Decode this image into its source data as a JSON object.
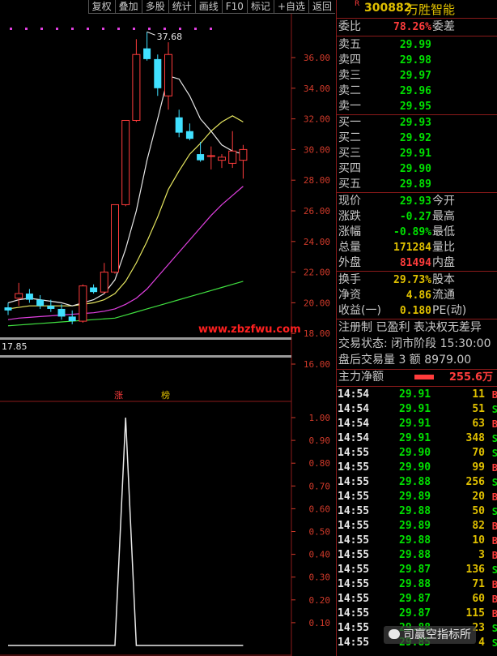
{
  "toolbar": {
    "buttons": [
      "复权",
      "叠加",
      "多股",
      "统计",
      "画线",
      "F10",
      "标记",
      "+自选",
      "返回"
    ]
  },
  "colors": {
    "background": "#000000",
    "up_red": "#ff3c3c",
    "down_cyan": "#40e0ff",
    "ma5_white": "#e8e8e8",
    "ma10_yellow": "#e8e860",
    "ma20_magenta": "#e040e0",
    "ma60_green": "#40e040",
    "volume_yellow": "#e0c000"
  },
  "main_chart": {
    "y_ticks": [
      "36.00",
      "34.00",
      "32.00",
      "30.00",
      "28.00",
      "26.00",
      "24.00",
      "22.00",
      "20.00",
      "18.00",
      "16.00"
    ],
    "high_label": "37.68",
    "low_label": "17.85",
    "watermark": "www.zbzfwu.com",
    "candles": [
      {
        "o": 19.7,
        "h": 20.0,
        "l": 19.2,
        "c": 19.5
      },
      {
        "o": 20.3,
        "h": 21.3,
        "l": 19.8,
        "c": 20.6
      },
      {
        "o": 20.6,
        "h": 20.9,
        "l": 20.0,
        "c": 20.2
      },
      {
        "o": 20.2,
        "h": 20.5,
        "l": 19.6,
        "c": 19.8
      },
      {
        "o": 19.8,
        "h": 20.2,
        "l": 19.4,
        "c": 19.6
      },
      {
        "o": 19.6,
        "h": 19.9,
        "l": 18.9,
        "c": 19.1
      },
      {
        "o": 19.1,
        "h": 19.5,
        "l": 18.6,
        "c": 18.8
      },
      {
        "o": 18.8,
        "h": 21.2,
        "l": 18.7,
        "c": 21.1
      },
      {
        "o": 21.0,
        "h": 21.2,
        "l": 20.6,
        "c": 20.7
      },
      {
        "o": 20.7,
        "h": 22.6,
        "l": 20.6,
        "c": 22.0
      },
      {
        "o": 22.0,
        "h": 26.4,
        "l": 21.9,
        "c": 26.4
      },
      {
        "o": 26.4,
        "h": 31.9,
        "l": 26.3,
        "c": 31.9
      },
      {
        "o": 31.9,
        "h": 37.2,
        "l": 31.8,
        "c": 36.2
      },
      {
        "o": 36.6,
        "h": 37.68,
        "l": 35.8,
        "c": 35.9
      },
      {
        "o": 35.9,
        "h": 36.2,
        "l": 33.5,
        "c": 34.0
      },
      {
        "o": 33.5,
        "h": 37.0,
        "l": 32.6,
        "c": 36.2
      },
      {
        "o": 32.1,
        "h": 32.6,
        "l": 30.8,
        "c": 31.1
      },
      {
        "o": 31.2,
        "h": 31.7,
        "l": 30.6,
        "c": 30.7
      },
      {
        "o": 29.7,
        "h": 30.5,
        "l": 29.2,
        "c": 29.3
      },
      {
        "o": 29.6,
        "h": 30.2,
        "l": 28.7,
        "c": 29.6
      },
      {
        "o": 29.3,
        "h": 29.7,
        "l": 28.8,
        "c": 29.5
      },
      {
        "o": 29.1,
        "h": 31.2,
        "l": 28.8,
        "c": 29.9
      },
      {
        "o": 29.3,
        "h": 30.3,
        "l": 28.1,
        "c": 30.0
      }
    ],
    "ma5": [
      20.0,
      20.2,
      20.3,
      20.2,
      20.1,
      20.0,
      19.8,
      20.0,
      20.2,
      20.6,
      21.5,
      23.5,
      26.0,
      29.3,
      32.0,
      34.8,
      34.6,
      33.5,
      32.0,
      31.2,
      30.3,
      29.9,
      29.7
    ],
    "ma10": [
      19.6,
      19.7,
      19.8,
      19.8,
      19.8,
      19.8,
      19.8,
      19.9,
      20.0,
      20.2,
      20.6,
      21.4,
      22.6,
      24.0,
      25.6,
      27.4,
      28.6,
      29.7,
      30.4,
      31.2,
      31.8,
      32.2,
      31.8
    ],
    "ma20": [
      18.9,
      19.0,
      19.05,
      19.1,
      19.15,
      19.2,
      19.25,
      19.3,
      19.35,
      19.45,
      19.6,
      19.9,
      20.3,
      20.9,
      21.7,
      22.5,
      23.3,
      24.1,
      24.9,
      25.7,
      26.4,
      27.0,
      27.6
    ],
    "ma60": [
      18.5,
      18.55,
      18.6,
      18.65,
      18.7,
      18.75,
      18.8,
      18.85,
      18.9,
      18.95,
      19.0,
      19.2,
      19.4,
      19.6,
      19.8,
      20.0,
      20.2,
      20.4,
      20.6,
      20.8,
      21.0,
      21.2,
      21.4
    ]
  },
  "sub_chart": {
    "markers": [
      "涨",
      "榜"
    ],
    "y_ticks": [
      "1.00",
      "0.90",
      "0.80",
      "0.70",
      "0.60",
      "0.50",
      "0.40",
      "0.30",
      "0.20",
      "0.10"
    ],
    "values": [
      0,
      0,
      0,
      0,
      0,
      0,
      0,
      0,
      0,
      0,
      0,
      1,
      0,
      0,
      0,
      0,
      0,
      0,
      0,
      0,
      0,
      0,
      0
    ]
  },
  "quote": {
    "code": "300882",
    "name": "万胜智能",
    "r_badge": "R",
    "weibi_label": "委比",
    "weibi_value": "78.26%",
    "weicha_label": "委差",
    "asks": [
      {
        "label": "卖五",
        "price": "29.99"
      },
      {
        "label": "卖四",
        "price": "29.98"
      },
      {
        "label": "卖三",
        "price": "29.97"
      },
      {
        "label": "卖二",
        "price": "29.96"
      },
      {
        "label": "卖一",
        "price": "29.95"
      }
    ],
    "bids": [
      {
        "label": "买一",
        "price": "29.93"
      },
      {
        "label": "买二",
        "price": "29.92"
      },
      {
        "label": "买三",
        "price": "29.91"
      },
      {
        "label": "买四",
        "price": "29.90"
      },
      {
        "label": "买五",
        "price": "29.89"
      }
    ],
    "stats": [
      {
        "label": "现价",
        "value": "29.93",
        "label2": "今开"
      },
      {
        "label": "涨跌",
        "value": "-0.27",
        "label2": "最高"
      },
      {
        "label": "涨幅",
        "value": "-0.89%",
        "label2": "最低"
      },
      {
        "label": "总量",
        "value": "171284",
        "label2": "量比"
      },
      {
        "label": "外盘",
        "value": "81494",
        "label2": "内盘"
      }
    ],
    "stats2": [
      {
        "label": "换手",
        "value": "29.73%",
        "label2": "股本"
      },
      {
        "label": "净资",
        "value": "4.86",
        "label2": "流通"
      },
      {
        "label": "收益(一)",
        "value": "0.180",
        "label2": "PE(动)"
      }
    ],
    "notice": "注册制 已盈利 表决权无差异",
    "status": "交易状态: 闭市阶段 15:30:00",
    "after_hours": "盘后交易量 3 额 8979.00",
    "net_flow_label": "主力净额",
    "net_flow_value": "255.6万"
  },
  "ticks": [
    {
      "t": "14:54",
      "p": "29.91",
      "v": "11",
      "d": "B"
    },
    {
      "t": "14:54",
      "p": "29.91",
      "v": "51",
      "d": "S"
    },
    {
      "t": "14:54",
      "p": "29.91",
      "v": "63",
      "d": "B"
    },
    {
      "t": "14:54",
      "p": "29.91",
      "v": "348",
      "d": "S"
    },
    {
      "t": "14:55",
      "p": "29.90",
      "v": "70",
      "d": "S"
    },
    {
      "t": "14:55",
      "p": "29.90",
      "v": "99",
      "d": "B"
    },
    {
      "t": "14:55",
      "p": "29.88",
      "v": "256",
      "d": "S"
    },
    {
      "t": "14:55",
      "p": "29.89",
      "v": "20",
      "d": "B"
    },
    {
      "t": "14:55",
      "p": "29.88",
      "v": "50",
      "d": "S"
    },
    {
      "t": "14:55",
      "p": "29.89",
      "v": "82",
      "d": "B"
    },
    {
      "t": "14:55",
      "p": "29.88",
      "v": "10",
      "d": "B"
    },
    {
      "t": "14:55",
      "p": "29.88",
      "v": "3",
      "d": "B"
    },
    {
      "t": "14:55",
      "p": "29.87",
      "v": "136",
      "d": "S"
    },
    {
      "t": "14:55",
      "p": "29.88",
      "v": "71",
      "d": "B"
    },
    {
      "t": "14:55",
      "p": "29.87",
      "v": "60",
      "d": "B"
    },
    {
      "t": "14:55",
      "p": "29.87",
      "v": "115",
      "d": "B"
    },
    {
      "t": "14:55",
      "p": "29.88",
      "v": "23",
      "d": "S"
    },
    {
      "t": "14:55",
      "p": "29.85",
      "v": "4",
      "d": "S"
    }
  ],
  "watermark2": "司赢空指标所"
}
